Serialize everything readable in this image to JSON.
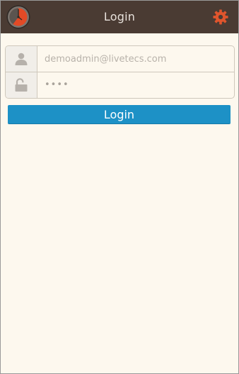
{
  "header": {
    "title": "Login",
    "logo_icon": "clock-logo-icon",
    "settings_icon": "gear-icon",
    "settings_color": "#e0552d"
  },
  "form": {
    "email_value": "demoadmin@livetecs.com",
    "user_icon": "user-icon",
    "password_masked": "••••",
    "lock_icon": "unlock-icon"
  },
  "actions": {
    "login_label": "Login",
    "login_color": "#1d91c6"
  },
  "colors": {
    "header_bg": "#4a3b33",
    "page_bg": "#fdf8ee"
  }
}
